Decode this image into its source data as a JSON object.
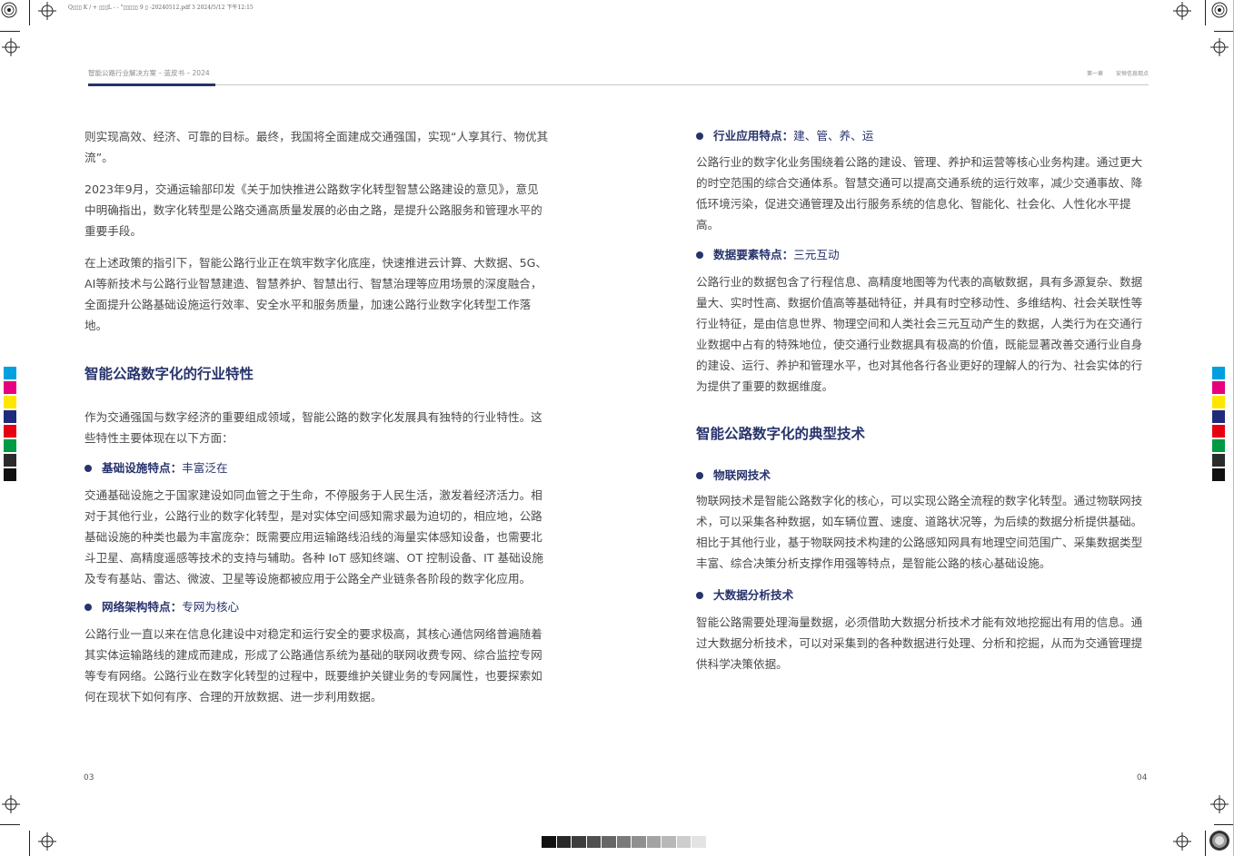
{
  "slug": "Q▯▯▯ K / + ▯▯▯L - - \"▯▯▯▯▯ 9 ▯ -20240512.pdf 3 2024/5/12 下午12:15",
  "header": {
    "left": "智能公路行业解决方案 – 蓝皮书 – 2024",
    "right_chapter": "第一章",
    "right_title": "安恒信息观点"
  },
  "left_col": {
    "p1": "则实现高效、经济、可靠的目标。最终，我国将全面建成交通强国，实现“人享其行、物优其流”。",
    "p2": "2023年9月，交通运输部印发《关于加快推进公路数字化转型智慧公路建设的意见》，意见中明确指出，数字化转型是公路交通高质量发展的必由之路，是提升公路服务和管理水平的重要手段。",
    "p3": "在上述政策的指引下，智能公路行业正在筑牢数字化底座，快速推进云计算、大数据、5G、AI等新技术与公路行业智慧建造、智慧养护、智慧出行、智慧治理等应用场景的深度融合，全面提升公路基础设施运行效率、安全水平和服务质量，加速公路行业数字化转型工作落地。",
    "h2": "智能公路数字化的行业特性",
    "p4": "作为交通强国与数字经济的重要组成领域，智能公路的数字化发展具有独特的行业特性。这些特性主要体现在以下方面：",
    "b1_key": "基础设施特点：",
    "b1_val": "丰富泛在",
    "p5": "交通基础设施之于国家建设如同血管之于生命，不停服务于人民生活，激发着经济活力。相对于其他行业，公路行业的数字化转型，是对实体空间感知需求最为迫切的，相应地，公路基础设施的种类也最为丰富庞杂：既需要应用运输路线沿线的海量实体感知设备，也需要北斗卫星、高精度遥感等技术的支持与辅助。各种 IoT 感知终端、OT 控制设备、IT 基础设施及专有基站、雷达、微波、卫星等设施都被应用于公路全产业链条各阶段的数字化应用。",
    "b2_key": "网络架构特点：",
    "b2_val": "专网为核心",
    "p6": "公路行业一直以来在信息化建设中对稳定和运行安全的要求极高，其核心通信网络普遍随着其实体运输路线的建成而建成，形成了公路通信系统为基础的联网收费专网、综合监控专网等专有网络。公路行业在数字化转型的过程中，既要维护关键业务的专网属性，也要探索如何在现状下如何有序、合理的开放数据、进一步利用数据。",
    "page_no": "03"
  },
  "right_col": {
    "b1_key": "行业应用特点：",
    "b1_val": "建、管、养、运",
    "p1": "公路行业的数字化业务围绕着公路的建设、管理、养护和运营等核心业务构建。通过更大的时空范围的综合交通体系。智慧交通可以提高交通系统的运行效率，减少交通事故、降低环境污染，促进交通管理及出行服务系统的信息化、智能化、社会化、人性化水平提高。",
    "b2_key": "数据要素特点：",
    "b2_val": "三元互动",
    "p2": "公路行业的数据包含了行程信息、高精度地图等为代表的高敏数据，具有多源复杂、数据量大、实时性高、数据价值高等基础特征，并具有时空移动性、多维结构、社会关联性等行业特征，是由信息世界、物理空间和人类社会三元互动产生的数据，人类行为在交通行业数据中占有的特殊地位，使交通行业数据具有极高的价值，既能显著改善交通行业自身的建设、运行、养护和管理水平，也对其他各行各业更好的理解人的行为、社会实体的行为提供了重要的数据维度。",
    "h2": "智能公路数字化的典型技术",
    "b3_key": "物联网技术",
    "p3": "物联网技术是智能公路数字化的核心，可以实现公路全流程的数字化转型。通过物联网技术，可以采集各种数据，如车辆位置、速度、道路状况等，为后续的数据分析提供基础。相比于其他行业，基于物联网技术构建的公路感知网具有地理空间范围广、采集数据类型丰富、综合决策分析支撑作用强等特点，是智能公路的核心基础设施。",
    "b4_key": "大数据分析技术",
    "p4": "智能公路需要处理海量数据，必须借助大数据分析技术才能有效地挖掘出有用的信息。通过大数据分析技术，可以对采集到的各种数据进行处理、分析和挖掘，从而为交通管理提供科学决策依据。",
    "page_no": "04"
  },
  "colors": {
    "accent": "#27336b",
    "swatches": [
      "#00a0e0",
      "#e6007e",
      "#ffe600",
      "#1f2a7a",
      "#e60012",
      "#009944",
      "#2b2b2b",
      "#111111"
    ],
    "gray_bar": [
      "#111111",
      "#2a2a2a",
      "#3d3d3d",
      "#505050",
      "#666666",
      "#7a7a7a",
      "#8f8f8f",
      "#a3a3a3",
      "#b8b8b8",
      "#cdcdcd",
      "#e3e3e3"
    ]
  },
  "icons": [
    "registration-mark-icon",
    "color-bar",
    "gray-scale-bar"
  ]
}
